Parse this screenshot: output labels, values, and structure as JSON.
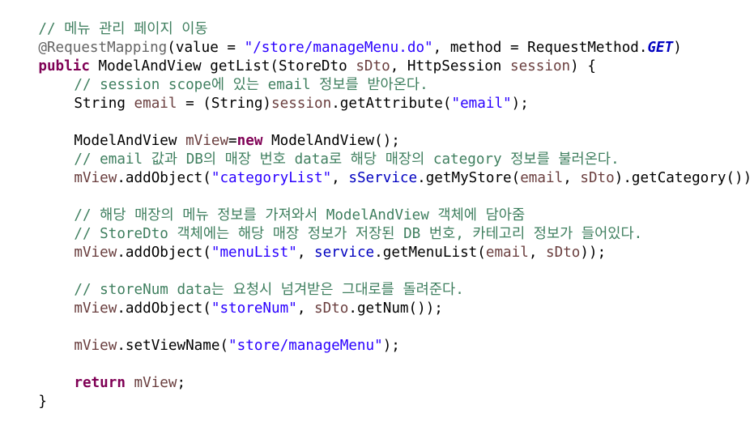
{
  "code": {
    "l1": {
      "c1": "// ",
      "c2": "메뉴 관리 페이지 이동"
    },
    "l2": {
      "ann": "@RequestMapping",
      "p1": "(value = ",
      "s1": "\"/store/manageMenu.do\"",
      "p2": ", method = RequestMethod.",
      "get": "GET",
      "p3": ")"
    },
    "l3": {
      "kw": "public",
      "p1": " ModelAndView getList(StoreDto ",
      "v1": "sDto",
      "p2": ", HttpSession ",
      "v2": "session",
      "p3": ") {"
    },
    "l4": {
      "c1": "// session scope",
      "c2": "에 있는 ",
      "c3": "email",
      "c4": " 정보를 받아온다."
    },
    "l5": {
      "p1": "String ",
      "v1": "email",
      "p2": " = (String)",
      "v2": "session",
      "p3": ".getAttribute(",
      "s1": "\"email\"",
      "p4": ");"
    },
    "l7": {
      "p1": "ModelAndView ",
      "v1": "mView",
      "p2": "=",
      "kw": "new",
      "p3": " ModelAndView();"
    },
    "l8": {
      "c1": "// email ",
      "c2": "값과 ",
      "c3": "DB",
      "c4": "의 매장 번호 ",
      "c5": "data",
      "c6": "로 해당 매장의 ",
      "c7": "category",
      "c8": " 정보를 불러온다."
    },
    "l9": {
      "v1": "mView",
      "p1": ".addObject(",
      "s1": "\"categoryList\"",
      "p2": ", ",
      "f1": "sService",
      "p3": ".getMyStore(",
      "v2": "email",
      "p4": ", ",
      "v3": "sDto",
      "p5": ").getCategory());"
    },
    "l11": {
      "c1": "// ",
      "c2": "해당 매장의 메뉴 정보를 가져와서 ",
      "c3": "ModelAndView",
      "c4": " 객체에 담아줌"
    },
    "l12": {
      "c1": "// StoreDto ",
      "c2": "객체에는 해당 매장 정보가 저장된 ",
      "c3": "DB",
      "c4": " 번호, 카테고리 정보가 들어있다."
    },
    "l13": {
      "v1": "mView",
      "p1": ".addObject(",
      "s1": "\"menuList\"",
      "p2": ", ",
      "f1": "service",
      "p3": ".getMenuList(",
      "v2": "email",
      "p4": ", ",
      "v3": "sDto",
      "p5": "));"
    },
    "l15": {
      "c1": "// storeNum data",
      "c2": "는 요청시 넘겨받은 그대로를 돌려준다."
    },
    "l16": {
      "v1": "mView",
      "p1": ".addObject(",
      "s1": "\"storeNum\"",
      "p2": ", ",
      "v2": "sDto",
      "p3": ".getNum());"
    },
    "l18": {
      "v1": "mView",
      "p1": ".setViewName(",
      "s1": "\"store/manageMenu\"",
      "p2": ");"
    },
    "l20": {
      "kw": "return",
      "p1": " ",
      "v1": "mView",
      "p2": ";"
    },
    "l21": {
      "p1": "}"
    }
  },
  "colors": {
    "comment": "#3f7f5f",
    "annotation": "#646464",
    "keyword": "#7f0055",
    "string": "#2a00ff",
    "field": "#0000c0",
    "variable": "#6a3e3e"
  }
}
